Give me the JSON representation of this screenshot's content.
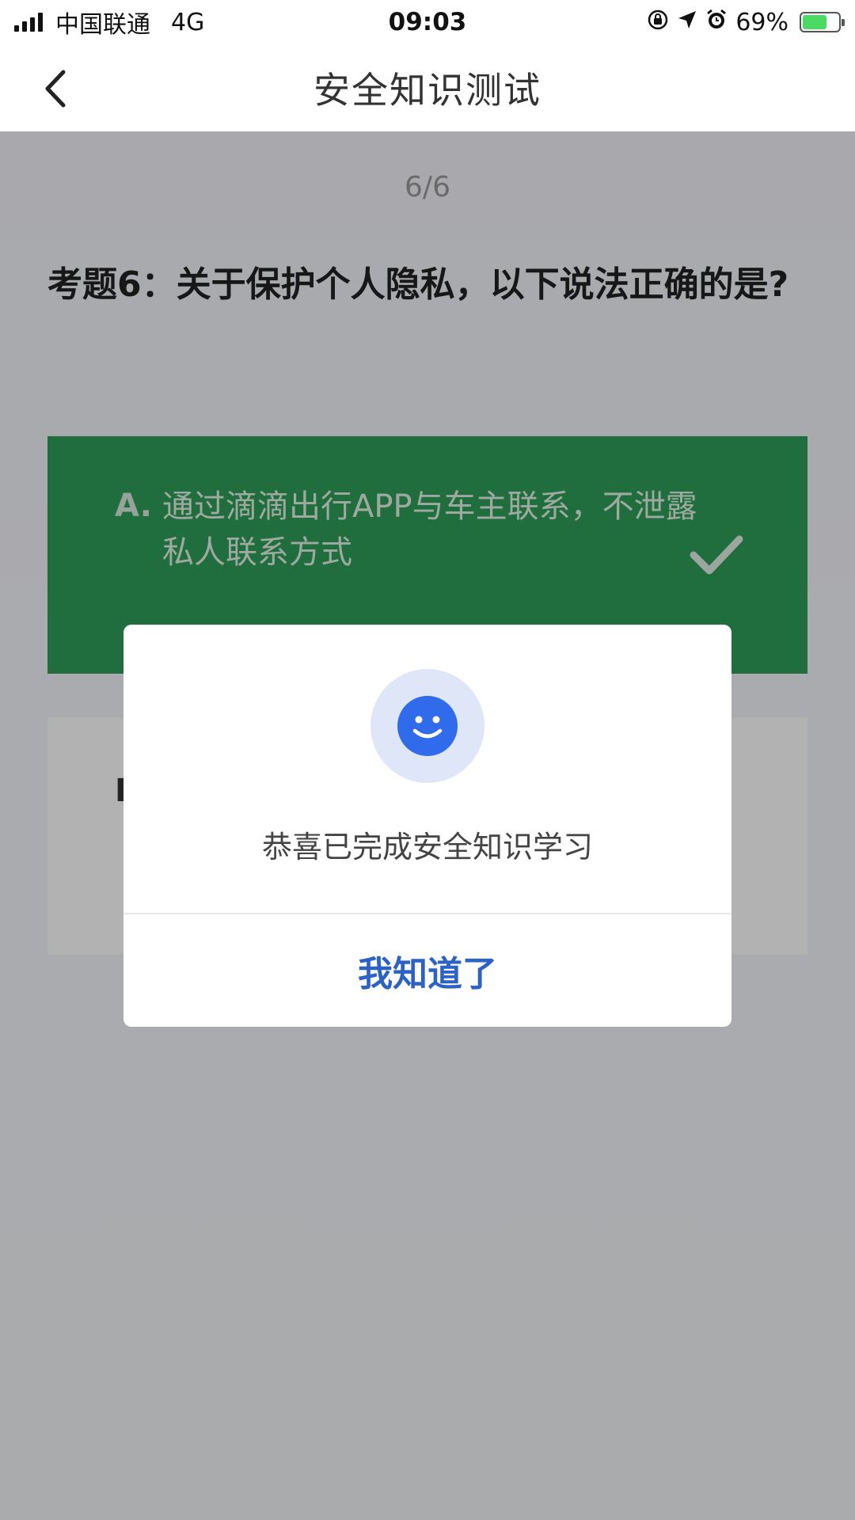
{
  "status_bar": {
    "carrier": "中国联通",
    "network": "4G",
    "time": "09:03",
    "battery_percent": "69%",
    "battery_level": 0.69
  },
  "nav": {
    "title": "安全知识测试"
  },
  "quiz": {
    "progress": "6/6",
    "question": "考题6：关于保护个人隐私，以下说法正确的是?",
    "options": [
      {
        "letter": "A.",
        "text": "通过滴滴出行APP与车主联系，不泄露私人联系方式",
        "state": "correct"
      },
      {
        "letter": "B"
      }
    ]
  },
  "dialog": {
    "message": "恭喜已完成安全知识学习",
    "button_label": "我知道了"
  },
  "colors": {
    "correct_green": "#2e9c58",
    "accent_blue": "#2c62c4",
    "smile_blue": "#2f6bea"
  }
}
